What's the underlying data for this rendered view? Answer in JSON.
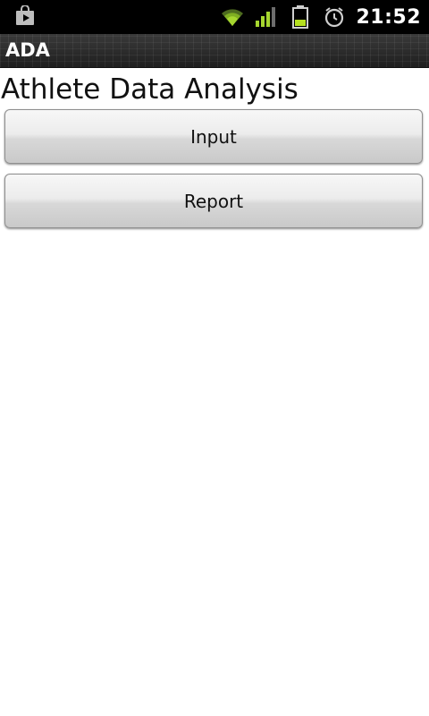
{
  "status_bar": {
    "time": "21:52",
    "icons": [
      "store-bag-icon",
      "wifi-icon",
      "signal-icon",
      "battery-icon",
      "alarm-icon"
    ],
    "accent_color": "#9acd32"
  },
  "title_bar": {
    "title": "ADA"
  },
  "main": {
    "heading": "Athlete Data Analysis",
    "buttons": {
      "input": "Input",
      "report": "Report"
    }
  }
}
